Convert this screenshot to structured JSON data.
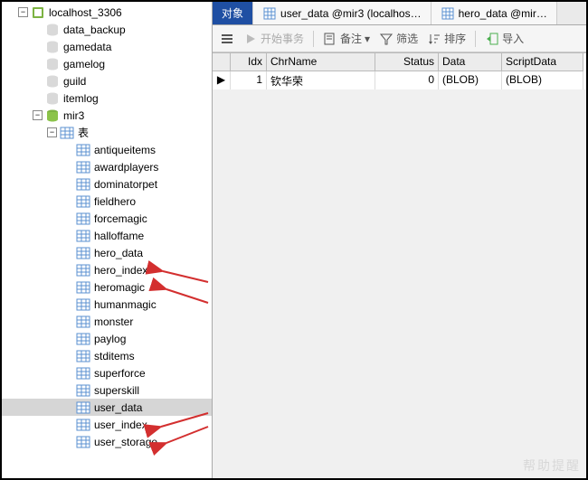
{
  "tree": {
    "root": "localhost_3306",
    "databases": [
      "data_backup",
      "gamedata",
      "gamelog",
      "guild",
      "itemlog"
    ],
    "active_db": "mir3",
    "tables_label": "表",
    "tables": [
      "antiqueitems",
      "awardplayers",
      "dominatorpet",
      "fieldhero",
      "forcemagic",
      "halloffame",
      "hero_data",
      "hero_index",
      "heromagic",
      "humanmagic",
      "monster",
      "paylog",
      "stditems",
      "superforce",
      "superskill",
      "user_data",
      "user_index",
      "user_storage"
    ],
    "highlight": "user_data",
    "arrows": [
      "hero_data",
      "hero_index",
      "user_data",
      "user_index"
    ]
  },
  "tabs": {
    "items": [
      {
        "label": "对象",
        "active": true
      },
      {
        "label": "user_data @mir3 (localhos…",
        "active": false
      },
      {
        "label": "hero_data @mir…",
        "active": false
      }
    ]
  },
  "toolbar": {
    "start": "开始事务",
    "memo": "备注",
    "filter": "筛选",
    "sort": "排序",
    "import": "导入"
  },
  "grid": {
    "columns": [
      "Idx",
      "ChrName",
      "Status",
      "Data",
      "ScriptData"
    ],
    "rows": [
      {
        "idx": "1",
        "name": "钦华荣",
        "status": "0",
        "data": "(BLOB)",
        "script": "(BLOB)"
      }
    ]
  },
  "watermark": "帮助提醒"
}
